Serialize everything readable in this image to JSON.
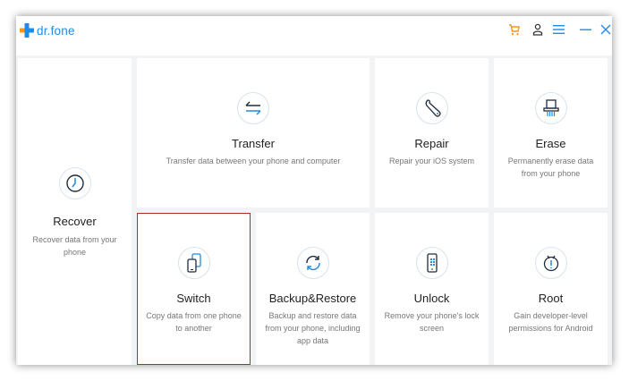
{
  "app": {
    "name": "dr.fone",
    "accent": "#1d8ce8",
    "logo_orange": "#f7941d"
  },
  "titlebar": {
    "cart_icon": "cart-icon",
    "account_icon": "user-icon",
    "menu_icon": "menu-icon",
    "minimize_icon": "minimize-icon",
    "close_icon": "close-icon"
  },
  "modules": {
    "recover": {
      "title": "Recover",
      "desc": "Recover data from your phone",
      "icon": "clock-icon"
    },
    "transfer": {
      "title": "Transfer",
      "desc": "Transfer data between your phone and computer",
      "icon": "transfer-arrows-icon"
    },
    "repair": {
      "title": "Repair",
      "desc": "Repair your iOS system",
      "icon": "wrench-icon"
    },
    "erase": {
      "title": "Erase",
      "desc": "Permanently erase data from your phone",
      "icon": "shredder-icon"
    },
    "switch": {
      "title": "Switch",
      "desc": "Copy data from one phone to another",
      "icon": "phones-switch-icon",
      "selected": true
    },
    "backup": {
      "title": "Backup&Restore",
      "desc": "Backup and restore data from your phone, including app data",
      "icon": "sync-icon"
    },
    "unlock": {
      "title": "Unlock",
      "desc": "Remove your phone's lock screen",
      "icon": "phone-lock-icon"
    },
    "root": {
      "title": "Root",
      "desc": "Gain developer-level permissions for Android",
      "icon": "android-icon"
    }
  }
}
